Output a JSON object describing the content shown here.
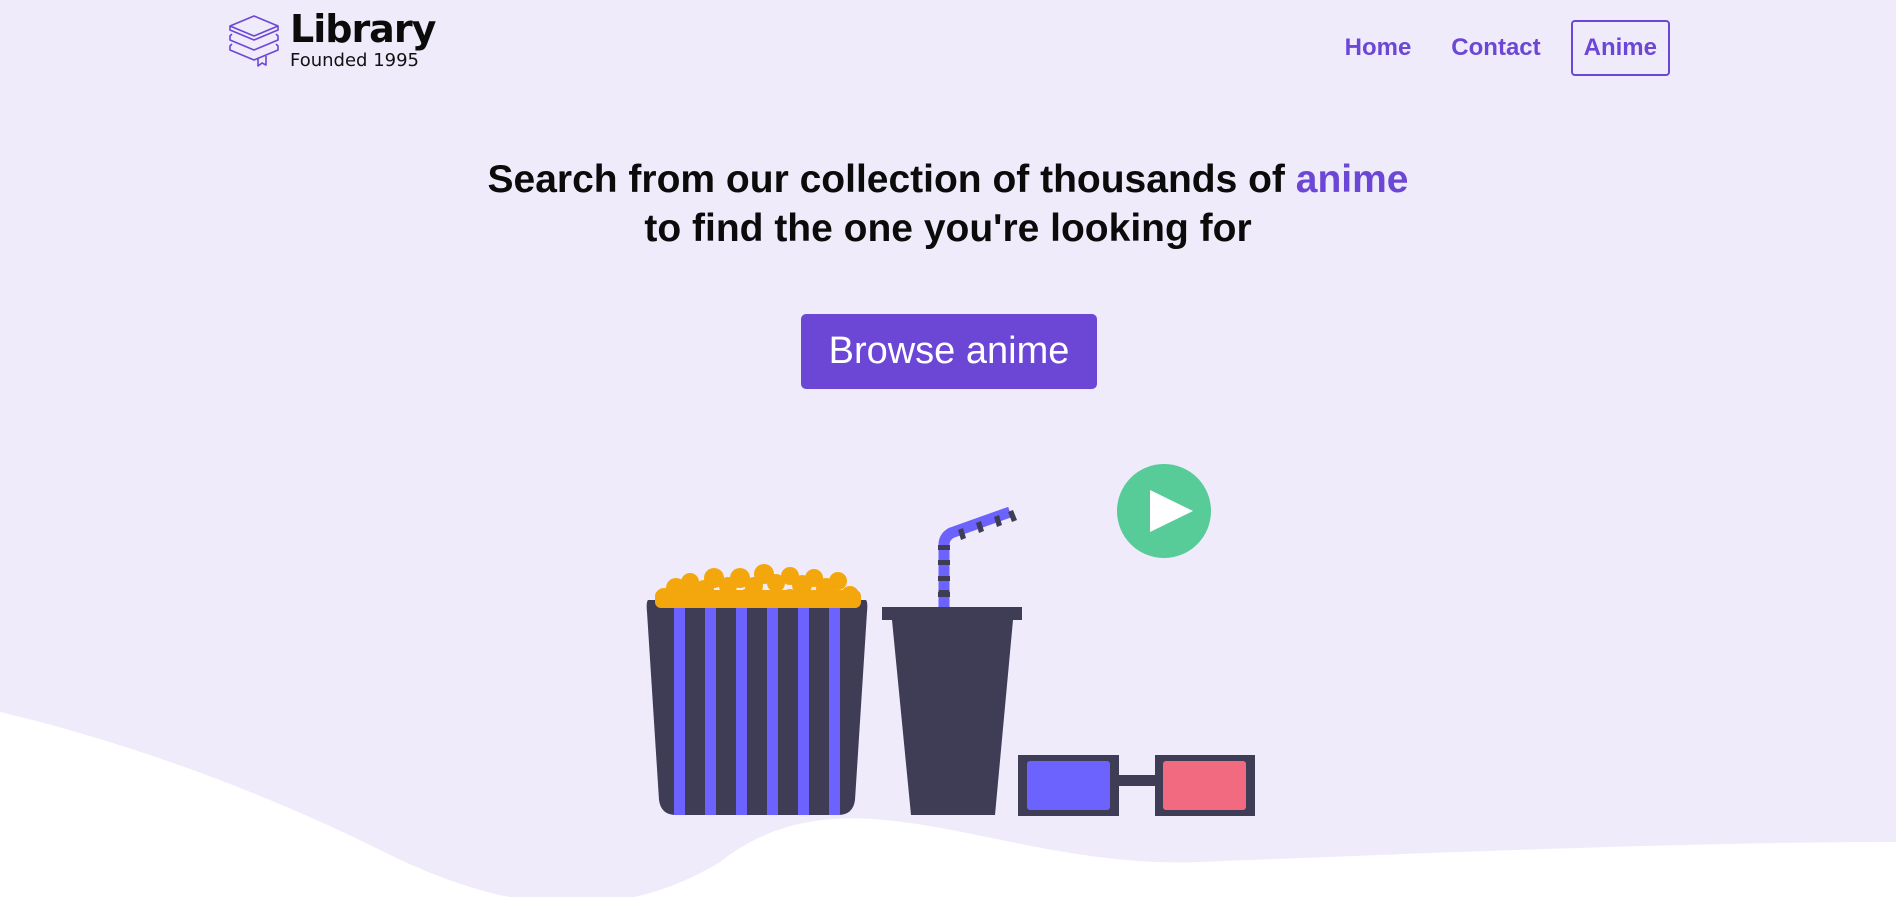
{
  "header": {
    "logo_title": "Library",
    "logo_subtitle": "Founded 1995",
    "nav": [
      {
        "label": "Home"
      },
      {
        "label": "Contact"
      },
      {
        "label": "Anime"
      }
    ]
  },
  "hero": {
    "title_part1": "Search from our collection of thousands of ",
    "title_accent": "anime",
    "title_part2": "to find the one you're looking for",
    "cta_label": "Browse anime"
  },
  "colors": {
    "accent": "#6c47d6",
    "hero_background": "#efebfa",
    "popcorn": "#f4a70c",
    "dark": "#3f3d56",
    "stripe": "#6c63ff",
    "play": "#5bd19c",
    "lens_red": "#f26a80"
  },
  "icons": {
    "logo": "books-stack-icon",
    "play": "play-icon"
  }
}
